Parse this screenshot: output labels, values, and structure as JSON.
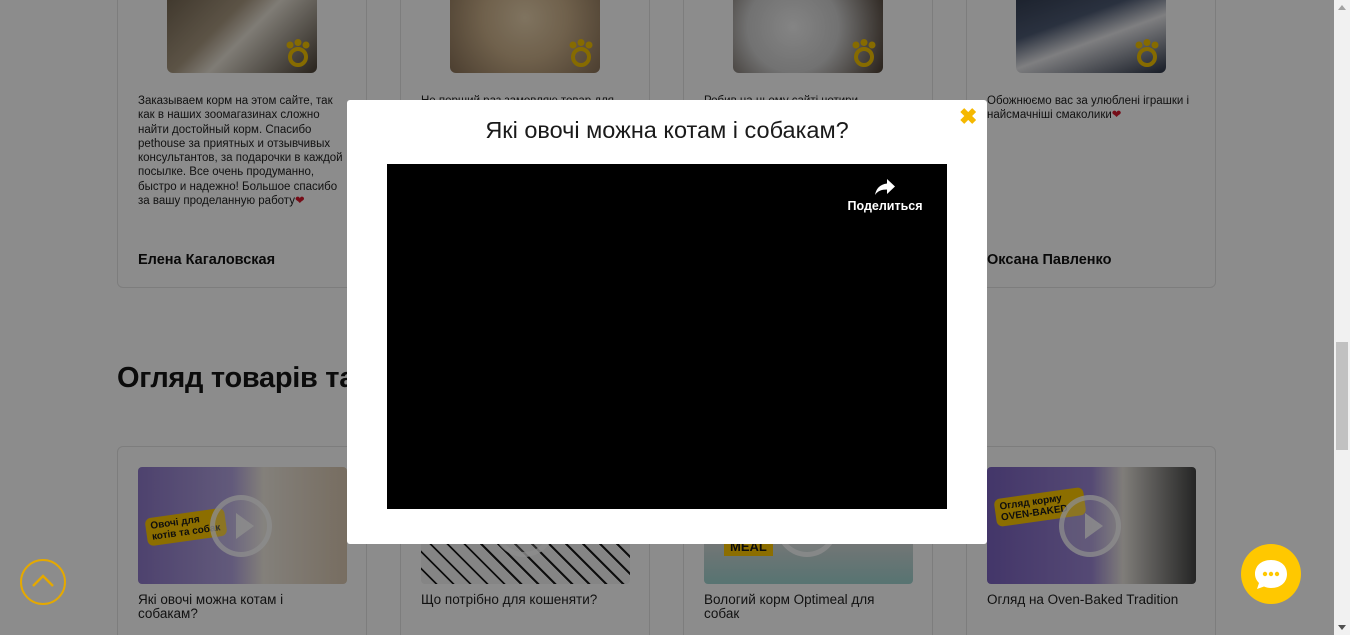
{
  "reviews": [
    {
      "text": "Заказываем корм на этом сайте, так как в наших зоомагазинах сложно найти достойный корм. Спасибо pethouse за приятных и отзывчивых консультантов, за подарочки в каждой посылке. Все очень продуманно, быстро и надежно! Большое спасибо за вашу проделанную работу",
      "emoji": "❤",
      "author": "Елена Кагаловская"
    },
    {
      "text": "Не перший раз замовляю товар для",
      "emoji": "",
      "author": ""
    },
    {
      "text": "Робив на цьому сайті чотири",
      "emoji": "",
      "author": ""
    },
    {
      "text": "Обожнюємо вас за улюблені іграшки і найсмачніші смаколики",
      "emoji": "❤",
      "author": "Оксана Павленко"
    }
  ],
  "section_title": "Огляд товарів та кормів",
  "videos": [
    {
      "thumb_title": "Овочі для котів та собак",
      "caption": "Які овочі можна котам і собакам?"
    },
    {
      "thumb_title": "",
      "caption": "Що потрібно для кошеняти?"
    },
    {
      "thumb_title": "MEAL",
      "caption": "Вологий корм Optimeal для собак"
    },
    {
      "thumb_title": "Огляд корму OVEN-BAKED",
      "caption": "Огляд на Oven-Baked Tradition"
    }
  ],
  "modal": {
    "title": "Які овочі можна котам і собакам?",
    "close_symbol": "✖",
    "share_label": "Поделиться"
  },
  "colors": {
    "accent": "#ffc800",
    "accent_dark": "#e5a900",
    "heart": "#d6172a"
  },
  "icons": {
    "scroll_up": "chevron-up-icon",
    "chat": "chat-bubble-icon",
    "share": "share-arrow-icon",
    "paw": "paw-icon",
    "close": "close-icon"
  }
}
